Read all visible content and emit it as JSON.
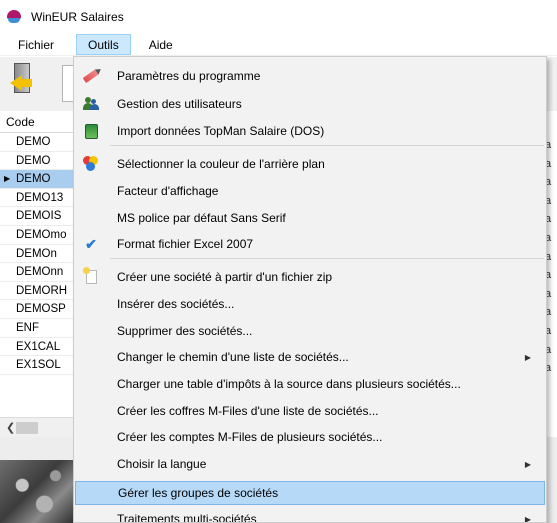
{
  "window": {
    "title": "WinEUR Salaires"
  },
  "menubar": {
    "items": [
      "Fichier",
      "Outils",
      "Aide"
    ]
  },
  "grid": {
    "header": "Code",
    "rows": [
      "DEMO",
      "DEMO",
      "DEMO",
      "DEMO13",
      "DEMOIS",
      "DEMOmo",
      "DEMOn",
      "DEMOnn",
      "DEMORH",
      "DEMOSP",
      "ENF",
      "EX1CAL",
      "EX1SOL"
    ],
    "selected_index": 2,
    "right_col_letter": "a"
  },
  "outils_menu": {
    "items": [
      {
        "label": "Paramètres du programme",
        "icon": "pencil-icon"
      },
      {
        "label": "Gestion des utilisateurs",
        "icon": "users-icon"
      },
      {
        "label": "Import données TopMan Salaire (DOS)",
        "icon": "import-icon"
      },
      {
        "label": "Sélectionner la couleur de l'arrière plan",
        "icon": "color-palette-icon"
      },
      {
        "label": "Facteur d'affichage"
      },
      {
        "label": "MS police par défaut Sans Serif"
      },
      {
        "label": "Format fichier Excel 2007",
        "icon": "check-icon",
        "checked": true
      },
      {
        "label": "Créer une société à partir d'un fichier zip",
        "icon": "zip-file-icon"
      },
      {
        "label": "Insérer des sociétés..."
      },
      {
        "label": "Supprimer des sociétés..."
      },
      {
        "label": "Changer le chemin d'une liste de sociétés...",
        "submenu": true
      },
      {
        "label": "Charger une table d'impôts à la source dans plusieurs sociétés..."
      },
      {
        "label": "Créer les coffres M-Files d'une liste de sociétés..."
      },
      {
        "label": "Créer les comptes M-Files de plusieurs sociétés..."
      },
      {
        "label": "Choisir la langue",
        "submenu": true
      },
      {
        "label": "Gérer les groupes de sociétés",
        "highlighted": true
      },
      {
        "label": "Traitements multi-sociétés",
        "submenu": true
      }
    ]
  }
}
